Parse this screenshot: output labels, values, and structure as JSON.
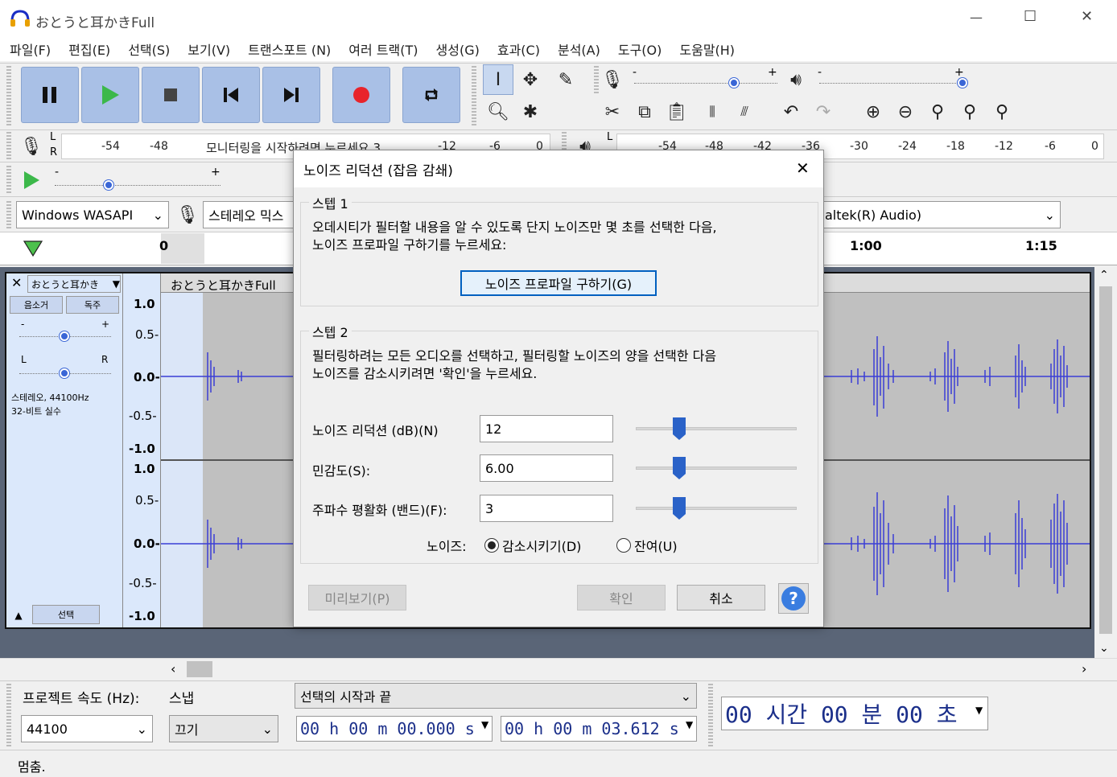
{
  "window": {
    "title": "おとうと耳かきFull",
    "minimize": "—",
    "maximize": "☐",
    "close": "✕"
  },
  "menu": [
    "파일(F)",
    "편집(E)",
    "선택(S)",
    "보기(V)",
    "트랜스포트 (N)",
    "여러 트랙(T)",
    "생성(G)",
    "효과(C)",
    "분석(A)",
    "도구(O)",
    "도움말(H)"
  ],
  "meters": {
    "rec_lr_top": "L",
    "rec_lr_bottom": "R",
    "rec_ticks": [
      "-54",
      "-48",
      "-12",
      "-6",
      "0"
    ],
    "monitor_text": "모니터링을 시작하려면 누르세요 3",
    "play_lr": "L",
    "play_ticks": [
      "-54",
      "-48",
      "-42",
      "-36",
      "-30",
      "-24",
      "-18",
      "-12",
      "-6",
      "0"
    ]
  },
  "sliders": {
    "rec_minus": "-",
    "rec_plus": "+",
    "play_minus": "-",
    "play_plus": "+",
    "speed_minus": "-",
    "speed_plus": "+"
  },
  "devices": {
    "host": "Windows WASAPI",
    "input": "스테레오 믹스",
    "output": "altek(R) Audio)"
  },
  "timeline": {
    "t0": "0",
    "t60": "1:00",
    "t75": "1:15"
  },
  "track": {
    "name": "おとうと耳かき",
    "close": "✕",
    "mute": "음소거",
    "solo": "독주",
    "gain_minus": "-",
    "gain_plus": "+",
    "pan_l": "L",
    "pan_r": "R",
    "info1": "스테레오, 44100Hz",
    "info2": "32-비트 실수",
    "select": "선택",
    "clip_name": "おとうと耳かきFull",
    "scale_top": [
      "1.0",
      "0.5-",
      "0.0-",
      "-0.5-",
      "-1.0"
    ],
    "scale_bottom": [
      "1.0",
      "0.5-",
      "0.0-",
      "-0.5-",
      "-1.0"
    ]
  },
  "dialog": {
    "title": "노이즈 리덕션 (잡음 감쇄)",
    "step1": "스텝 1",
    "step1_text1": "오데시티가 필터할 내용을 알 수 있도록 단지 노이즈만 몇 초를 선택한 다음,",
    "step1_text2": "노이즈 프로파일 구하기를 누르세요:",
    "profile_button": "노이즈 프로파일 구하기(G)",
    "step2": "스텝 2",
    "step2_text1": "필터링하려는 모든 오디오를 선택하고, 필터링할 노이즈의 양을 선택한 다음",
    "step2_text2": "노이즈를 감소시키려면 '확인'을 누르세요.",
    "nr_label": "노이즈 리덕션 (dB)(N)",
    "nr_value": "12",
    "sens_label": "민감도(S):",
    "sens_value": "6.00",
    "freq_label": "주파수 평활화 (밴드)(F):",
    "freq_value": "3",
    "noise_label": "노이즈:",
    "opt_reduce": "감소시키기(D)",
    "opt_residue": "잔여(U)",
    "preview": "미리보기(P)",
    "ok": "확인",
    "cancel": "취소",
    "help": "?"
  },
  "bottom": {
    "rate_label": "프로젝트 속도 (Hz):",
    "rate_value": "44100",
    "snap_label": "스냅",
    "snap_value": "끄기",
    "sel_label": "선택의 시작과 끝",
    "start_time": "00 h 00 m 00.000 s",
    "end_time": "00 h 00 m 03.612 s",
    "big_time": "00 시간 00 분 00 초"
  },
  "status": {
    "text": "멈춤."
  }
}
